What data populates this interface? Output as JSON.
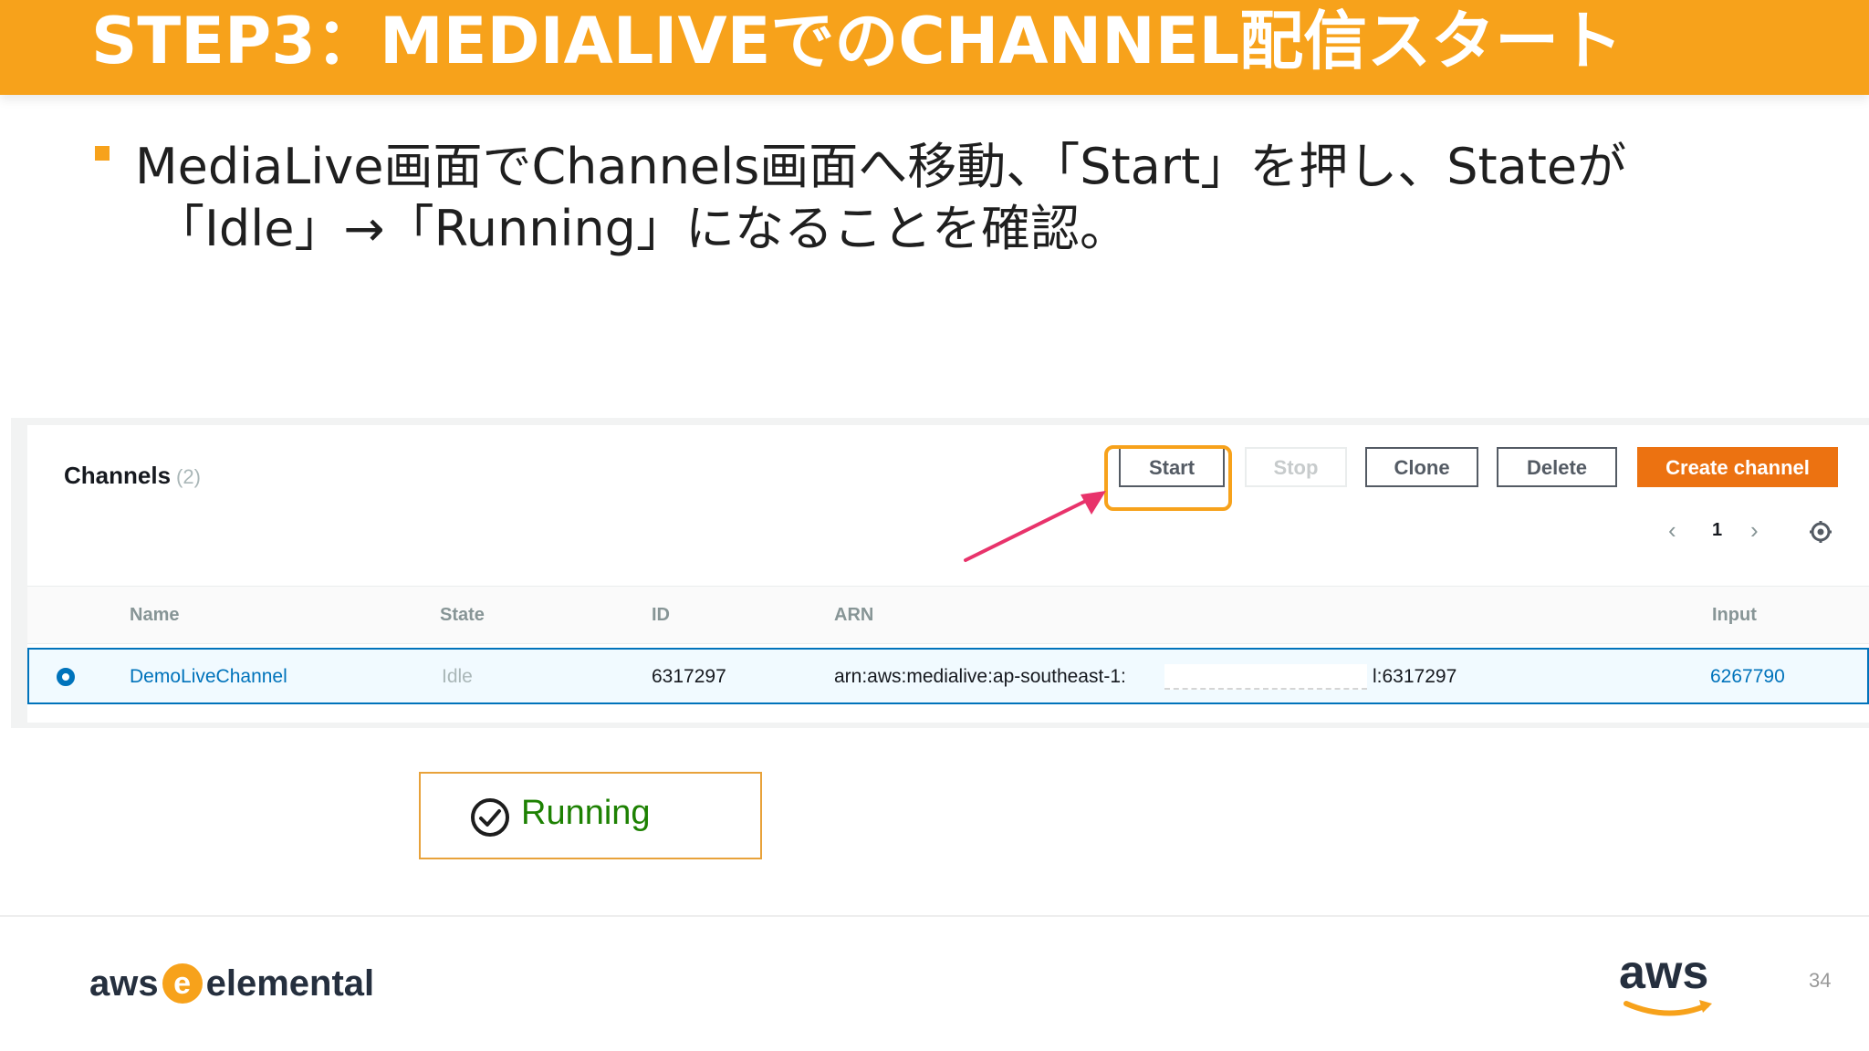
{
  "slide": {
    "title": "STEP3：MEDIALIVEでのCHANNEL配信スタート",
    "bullet_line1": "MediaLive画面でChannels画面へ移動、「Start」を押し、Stateが",
    "bullet_line2": "「Idle」→「Running」になることを確認。",
    "page_number": "34"
  },
  "console": {
    "header": {
      "title": "Channels",
      "count": "(2)"
    },
    "buttons": {
      "start": "Start",
      "stop": "Stop",
      "clone": "Clone",
      "delete": "Delete",
      "create": "Create channel"
    },
    "pagination": {
      "prev": "‹",
      "page": "1",
      "next": "›"
    },
    "columns": [
      "Name",
      "State",
      "ID",
      "ARN",
      "Input"
    ],
    "rows": [
      {
        "name": "DemoLiveChannel",
        "state": "Idle",
        "id": "6317297",
        "arn_prefix": "arn:aws:medialive:ap-southeast-1:",
        "arn_suffix": "l:6317297",
        "input": "6267790"
      }
    ]
  },
  "status": {
    "label": "Running"
  },
  "footer": {
    "brand_left_1": "aws",
    "brand_left_badge": "e",
    "brand_left_2": "elemental",
    "brand_right": "aws"
  },
  "colors": {
    "accent": "#f7a21b",
    "primary_button": "#ec7211",
    "link": "#0073bb",
    "running": "#1d8102",
    "arrow": "#e8336b"
  }
}
